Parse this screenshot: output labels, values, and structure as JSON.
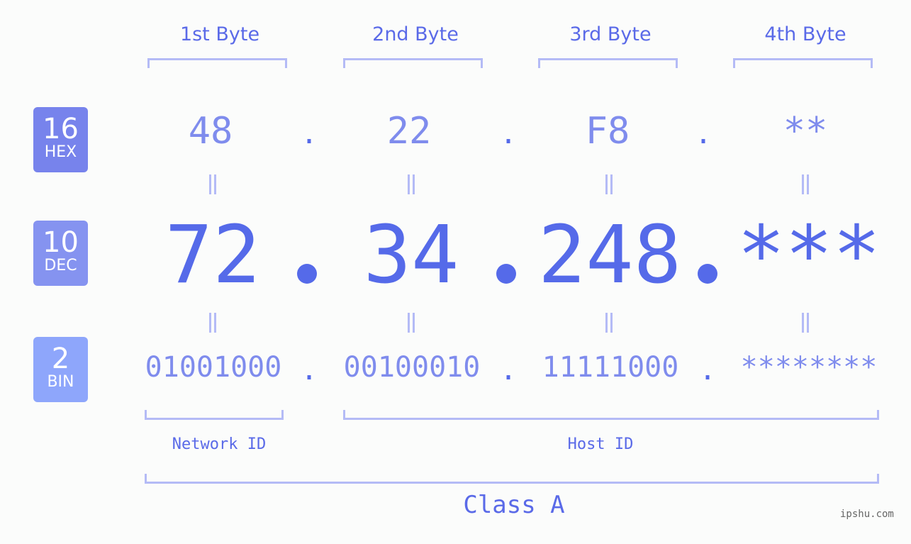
{
  "bytes": {
    "headers": [
      "1st Byte",
      "2nd Byte",
      "3rd Byte",
      "4th Byte"
    ]
  },
  "rows": {
    "hex": {
      "base": "16",
      "label": "HEX",
      "color": "#7783ec",
      "values": [
        "48",
        "22",
        "F8",
        "**"
      ]
    },
    "dec": {
      "base": "10",
      "label": "DEC",
      "color": "#8593f0",
      "values": [
        "72",
        "34",
        "248",
        "***"
      ]
    },
    "bin": {
      "base": "2",
      "label": "BIN",
      "color": "#8ea6fb",
      "values": [
        "01001000",
        "00100010",
        "11111000",
        "********"
      ]
    }
  },
  "separator": ".",
  "parts": {
    "network_id": "Network ID",
    "host_id": "Host ID"
  },
  "class_label": "Class A",
  "watermark": "ipshu.com"
}
